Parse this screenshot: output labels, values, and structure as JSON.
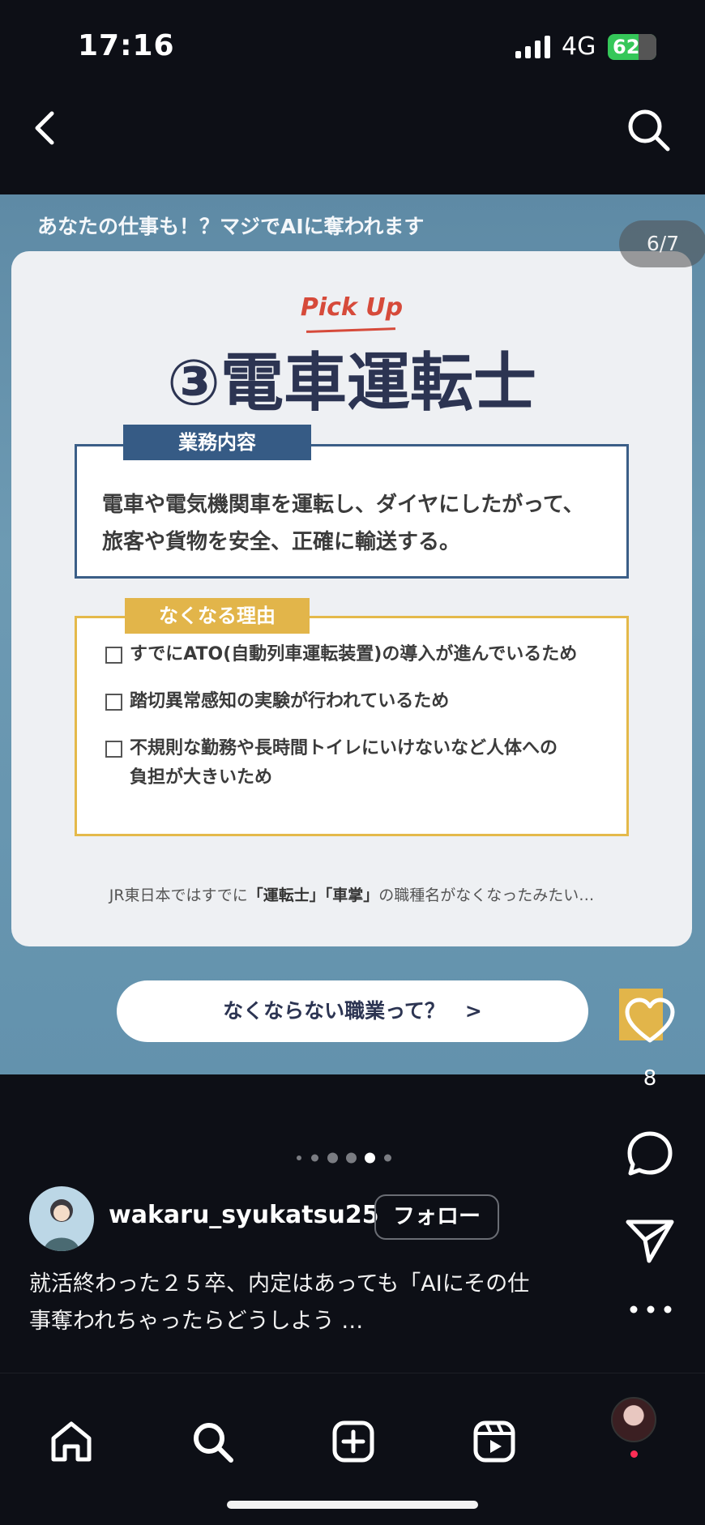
{
  "status_bar": {
    "time": "17:16",
    "network": "4G",
    "battery": "62"
  },
  "post": {
    "header_strip": "あなたの仕事も！？マジでAIに奪われます",
    "page_indicator": "6/7",
    "pick_up": "Pick Up",
    "title": "③電車運転士",
    "duties": {
      "tab": "業務内容",
      "line1": "電車や電気機関車を運転し、ダイヤにしたがって、",
      "line2": "旅客や貨物を安全、正確に輸送する。"
    },
    "reasons": {
      "tab": "なくなる理由",
      "items": [
        "すでにATO(自動列車運転装置)の導入が進んでいるため",
        "踏切異常感知の実験が行われているため",
        "不規則な勤務や長時間トイレにいけないなど人体への",
        "負担が大きいため"
      ]
    },
    "footnote": {
      "prefix": "JR東日本ではすでに",
      "term1": "「運転士」",
      "term2": "「車掌」",
      "suffix": "の職種名がなくなったみたい…"
    },
    "cta": "なくならない職業って？　>"
  },
  "actions": {
    "like_count": "8"
  },
  "account": {
    "username": "wakaru_syukatsu25",
    "follow_label": "フォロー"
  },
  "caption": {
    "line1": "就活終わった２５卒、内定はあっても「AIにその仕",
    "line2": "事奪われちゃったらどうしよう …"
  },
  "icons": {
    "back": "chevron-left-icon",
    "search": "search-icon",
    "like": "heart-icon",
    "comment": "comment-icon",
    "share": "send-icon",
    "more": "more-icon",
    "home": "home-icon",
    "create": "plus-square-icon",
    "reels": "reels-icon"
  },
  "colors": {
    "background": "#0d0f16",
    "title_navy": "#2c3452",
    "pickup_red": "#d64a3a",
    "duties_blue": "#365b85",
    "reasons_gold": "#e2b54a"
  }
}
